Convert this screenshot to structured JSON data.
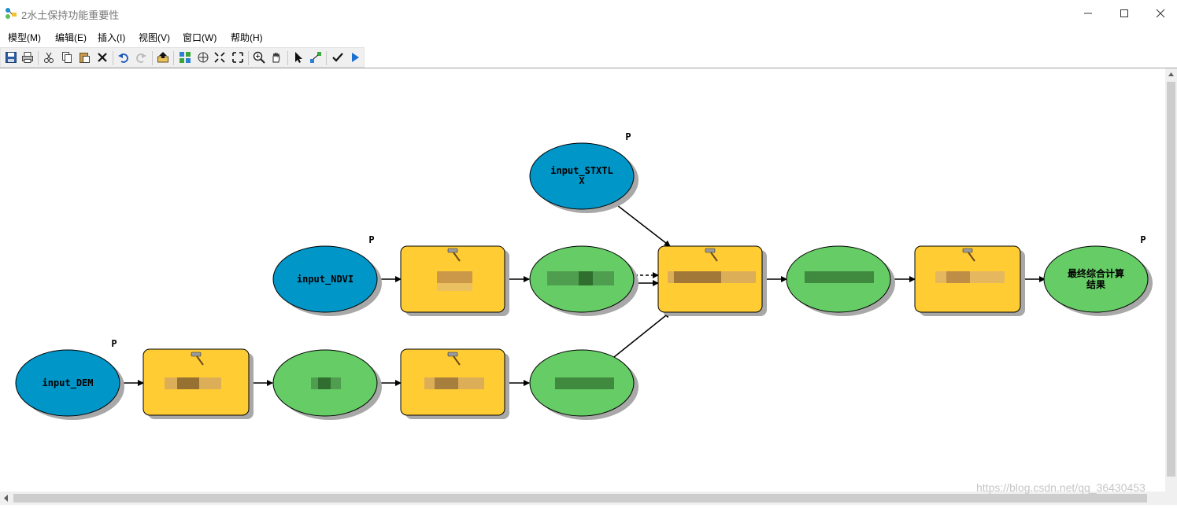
{
  "window": {
    "title": "2水土保持功能重要性"
  },
  "menu": [
    {
      "label": "模型(M)"
    },
    {
      "label": "编辑(E)"
    },
    {
      "label": "插入(I)"
    },
    {
      "label": "视图(V)"
    },
    {
      "label": "窗口(W)"
    },
    {
      "label": "帮助(H)"
    }
  ],
  "toolbar": [
    {
      "icon": "save-icon"
    },
    {
      "icon": "print-icon"
    },
    {
      "icon": "cut-icon"
    },
    {
      "icon": "copy-icon"
    },
    {
      "icon": "paste-icon"
    },
    {
      "icon": "delete-icon"
    },
    {
      "icon": "undo-icon"
    },
    {
      "icon": "redo-icon"
    },
    {
      "icon": "add-data-icon"
    },
    {
      "icon": "auto-layout-icon"
    },
    {
      "icon": "full-extent-icon"
    },
    {
      "icon": "fixed-zoom-out-icon"
    },
    {
      "icon": "fixed-zoom-in-icon"
    },
    {
      "icon": "zoom-in-icon"
    },
    {
      "icon": "pan-icon"
    },
    {
      "icon": "select-icon"
    },
    {
      "icon": "connect-icon"
    },
    {
      "icon": "validate-icon"
    },
    {
      "icon": "run-icon"
    }
  ],
  "model": {
    "param_marker": "P",
    "inputs": {
      "stxtlx": "input_STXTL X",
      "ndvi": "input_NDVI",
      "dem": "input_DEM"
    },
    "final_output": "最终综合计算 结果"
  },
  "colors": {
    "input_fill": "#0096c8",
    "tool_fill": "#ffcc33",
    "output_fill": "#66cc66",
    "shadow": "#a8a8a8"
  },
  "watermark": "https://blog.csdn.net/qq_36430453"
}
